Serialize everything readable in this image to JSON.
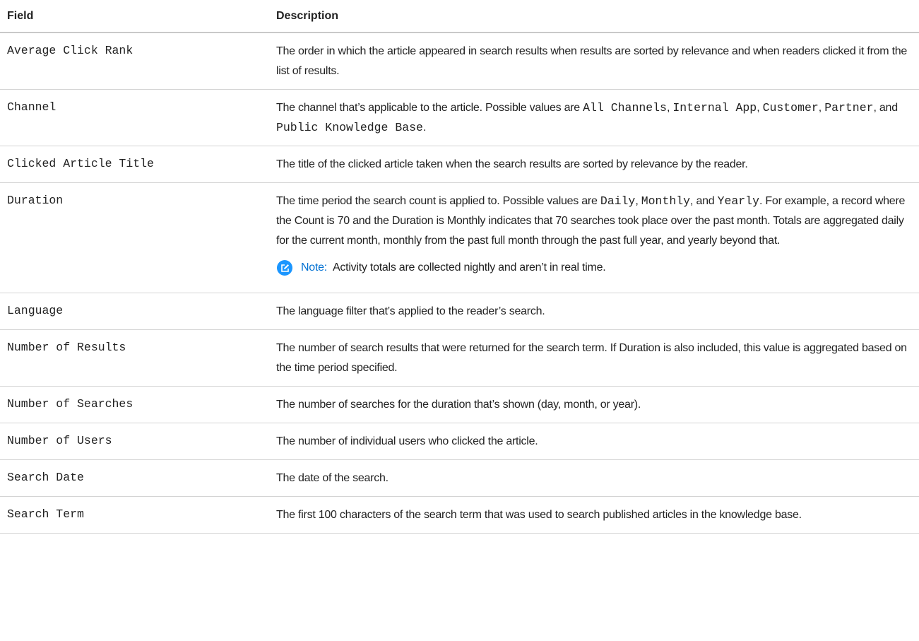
{
  "header": {
    "field": "Field",
    "description": "Description"
  },
  "rows": [
    {
      "field": "Average Click Rank",
      "desc": [
        {
          "t": "The order in which the article appeared in search results when results are sorted by relevance and when readers clicked it from the list of results."
        }
      ]
    },
    {
      "field": "Channel",
      "desc": [
        {
          "t": "The channel that’s applicable to the article. Possible values are "
        },
        {
          "c": "All Channels"
        },
        {
          "t": ", "
        },
        {
          "c": "Internal App"
        },
        {
          "t": ", "
        },
        {
          "c": "Customer"
        },
        {
          "t": ", "
        },
        {
          "c": "Partner"
        },
        {
          "t": ", and "
        },
        {
          "c": "Public Knowledge Base"
        },
        {
          "t": "."
        }
      ]
    },
    {
      "field": "Clicked Article Title",
      "desc": [
        {
          "t": "The title of the clicked article taken when the search results are sorted by relevance by the reader."
        }
      ]
    },
    {
      "field": "Duration",
      "desc": [
        {
          "t": "The time period the search count is applied to. Possible values are "
        },
        {
          "c": "Daily"
        },
        {
          "t": ", "
        },
        {
          "c": "Monthly"
        },
        {
          "t": ", and "
        },
        {
          "c": "Yearly"
        },
        {
          "t": ". For example, a record where the Count is 70 and the Duration is Monthly indicates that 70 searches took place over the past month. Totals are aggregated daily for the current month, monthly from the past full month through the past full year, and yearly beyond that."
        }
      ],
      "note": {
        "label": "Note:",
        "text": "Activity totals are collected nightly and aren’t in real time.",
        "icon": "edit-note-icon"
      }
    },
    {
      "field": "Language",
      "desc": [
        {
          "t": "The language filter that’s applied to the reader’s search."
        }
      ]
    },
    {
      "field": "Number of Results",
      "desc": [
        {
          "t": "The number of search results that were returned for the search term. If Duration is also included, this value is aggregated based on the time period specified."
        }
      ]
    },
    {
      "field": "Number of Searches",
      "desc": [
        {
          "t": "The number of searches for the duration that’s shown (day, month, or year)."
        }
      ]
    },
    {
      "field": "Number of Users",
      "desc": [
        {
          "t": "The number of individual users who clicked the article."
        }
      ]
    },
    {
      "field": "Search Date",
      "desc": [
        {
          "t": "The date of the search."
        }
      ]
    },
    {
      "field": "Search Term",
      "desc": [
        {
          "t": "The first 100 characters of the search term that was used to search published articles in the knowledge base."
        }
      ]
    }
  ],
  "colors": {
    "note_icon": "#1b96ff",
    "note_label": "#0070d2",
    "rule": "#d4d4d4"
  }
}
